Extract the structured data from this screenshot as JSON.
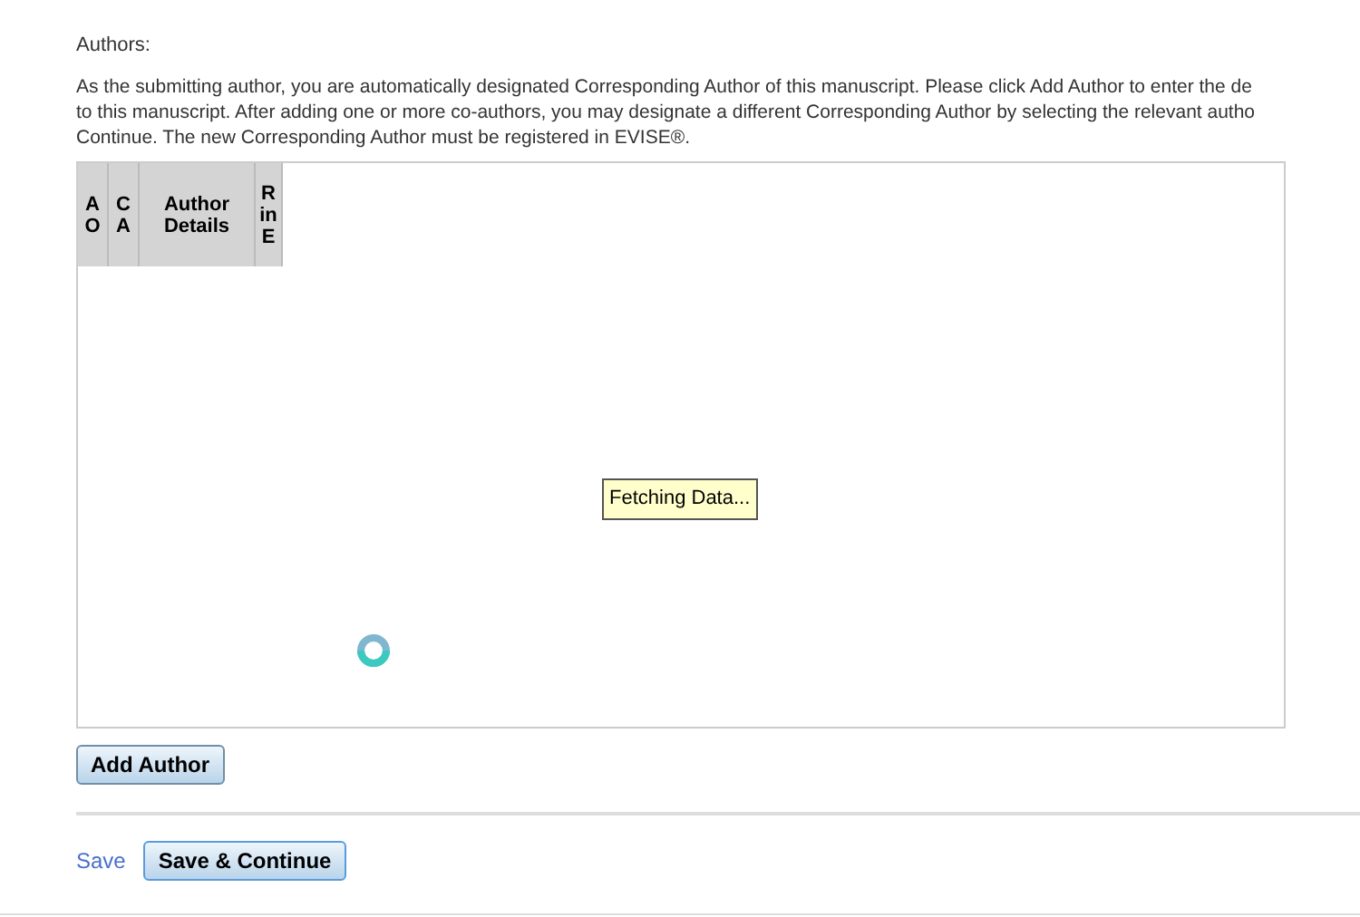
{
  "section_label": "Authors:",
  "instructions": [
    "As the submitting author, you are automatically designated Corresponding Author of this manuscript. Please click Add Author to enter the de",
    "to this manuscript. After adding one or more co-authors, you may designate a different Corresponding Author by selecting the relevant autho",
    "Continue. The new Corresponding Author must be registered in EVISE®."
  ],
  "table": {
    "columns": [
      {
        "lines": [
          "A",
          "O"
        ]
      },
      {
        "lines": [
          "C",
          "A"
        ]
      },
      {
        "lines": [
          "Author",
          "Details"
        ]
      },
      {
        "lines": [
          "R",
          "in",
          "E"
        ]
      }
    ],
    "loading_message": "Fetching Data..."
  },
  "add_button": "Add Author",
  "save_link": "Save",
  "save_continue_button": "Save & Continue"
}
